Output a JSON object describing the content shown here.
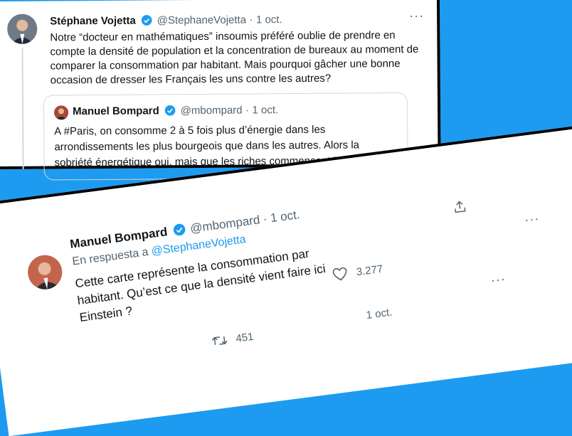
{
  "tweet1": {
    "author_name": "Stéphane Vojetta",
    "handle": "@StephaneVojetta",
    "separator": "·",
    "date": "1 oct.",
    "text": "Notre “docteur en mathématiques” insoumis préféré oublie de prendre en compte la densité de population et la concentration de bureaux au moment de comparer la consommation par habitant. Mais pourquoi gâcher une bonne occasion de dresser les Français les uns contre les autres?",
    "more_icon": "···"
  },
  "quoted": {
    "author_name": "Manuel Bompard",
    "handle": "@mbompard",
    "separator": "·",
    "date": "1 oct.",
    "text": "A #Paris, on consomme 2 à 5 fois plus d’énergie dans les arrondissements les plus bourgeois que dans les autres. Alors la sobriété énergétique oui, mais que les riches commencent !"
  },
  "tweet2": {
    "author_name": "Manuel Bompard",
    "handle": "@mbompard",
    "separator": "·",
    "date": "1 oct.",
    "reply_prefix": "En respuesta a",
    "reply_to": "@StephaneVojetta",
    "text": "Cette carte représente la consommation par habitant. Qu’est ce que la densité vient faire ici Einstein ?",
    "like_count": "3.277",
    "retweet_count": "451",
    "date2": "1 oct.",
    "more_icon": "···"
  },
  "colors": {
    "background": "#1d9bf0",
    "verified": "#1d9bf0",
    "muted": "#536471"
  }
}
